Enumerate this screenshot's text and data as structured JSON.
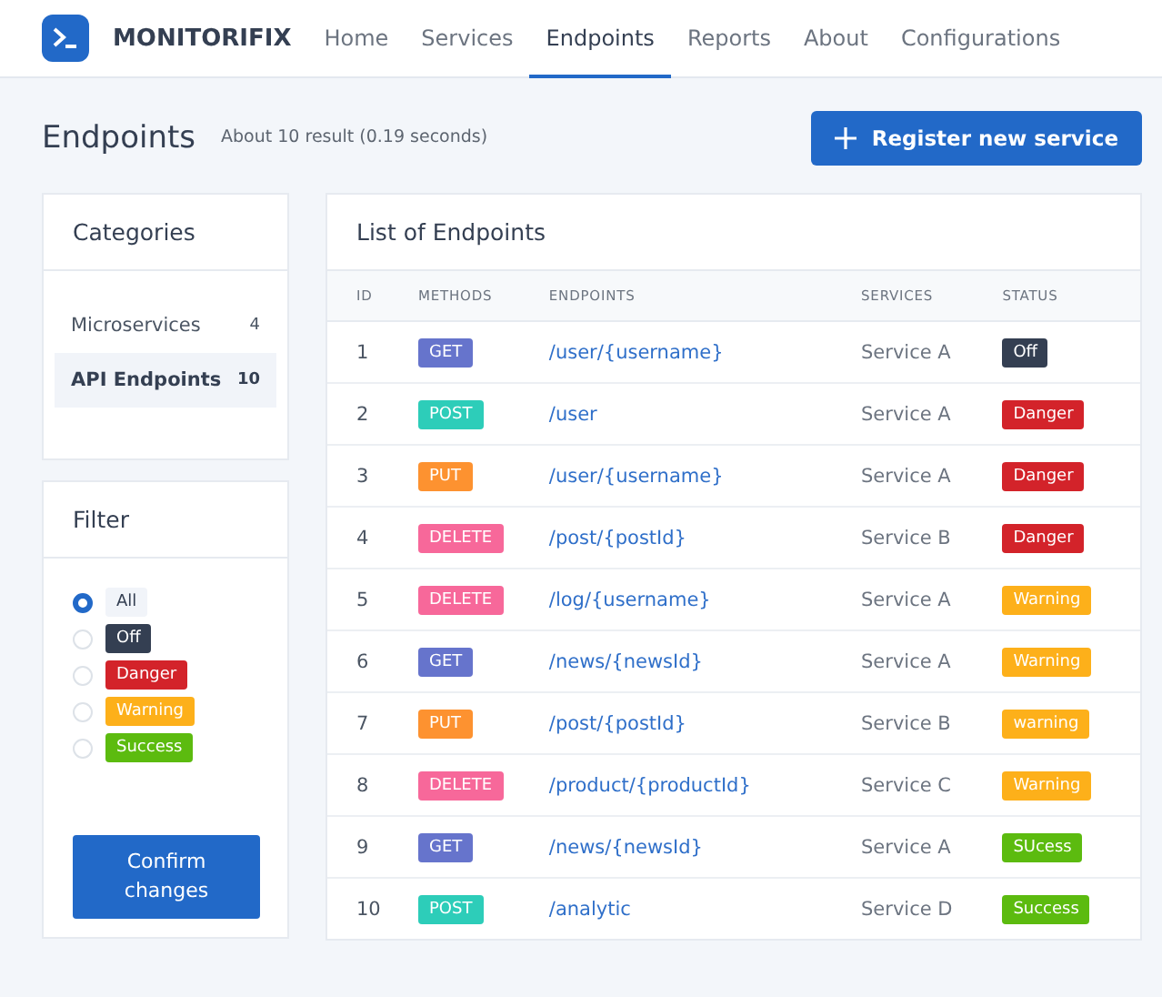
{
  "brand": {
    "name": "MONITORIFIX"
  },
  "nav": [
    {
      "label": "Home",
      "selected": false
    },
    {
      "label": "Services",
      "selected": false
    },
    {
      "label": "Endpoints",
      "selected": true
    },
    {
      "label": "Reports",
      "selected": false
    },
    {
      "label": "About",
      "selected": false
    },
    {
      "label": "Configurations",
      "selected": false
    }
  ],
  "page": {
    "title": "Endpoints",
    "result_info": "About 10 result (0.19 seconds)",
    "action_button": "Register new service"
  },
  "categories": {
    "title": "Categories",
    "items": [
      {
        "label": "Microservices",
        "count": "4",
        "selected": false
      },
      {
        "label": "API Endpoints",
        "count": "10",
        "selected": true
      }
    ]
  },
  "filter": {
    "title": "Filter",
    "options": [
      {
        "label": "All",
        "color": "#f1f4f9",
        "selected": true
      },
      {
        "label": "Off",
        "color": "#343f52",
        "selected": false
      },
      {
        "label": "Danger",
        "color": "#d3232a",
        "selected": false
      },
      {
        "label": "Warning",
        "color": "#fdb01a",
        "selected": false
      },
      {
        "label": "Success",
        "color": "#5cbb0f",
        "selected": false
      }
    ],
    "button": "Confirm changes"
  },
  "table": {
    "title": "List of Endpoints",
    "columns": [
      "ID",
      "METHODS",
      "ENDPOINTS",
      "SERVICES",
      "STATUS"
    ],
    "rows": [
      {
        "id": "1",
        "method": {
          "label": "GET",
          "color": "#6674cc"
        },
        "endpoint": "/user/{username}",
        "service": "Service A",
        "status": {
          "label": "Off",
          "color": "#343f52"
        }
      },
      {
        "id": "2",
        "method": {
          "label": "POST",
          "color": "#2dcdb9"
        },
        "endpoint": "/user",
        "service": "Service A",
        "status": {
          "label": "Danger",
          "color": "#d3232a"
        }
      },
      {
        "id": "3",
        "method": {
          "label": "PUT",
          "color": "#fd9230"
        },
        "endpoint": "/user/{username}",
        "service": "Service A",
        "status": {
          "label": "Danger",
          "color": "#d3232a"
        }
      },
      {
        "id": "4",
        "method": {
          "label": "DELETE",
          "color": "#f7689a"
        },
        "endpoint": "/post/{postId}",
        "service": "Service B",
        "status": {
          "label": "Danger",
          "color": "#d3232a"
        }
      },
      {
        "id": "5",
        "method": {
          "label": "DELETE",
          "color": "#f7689a"
        },
        "endpoint": "/log/{username}",
        "service": "Service A",
        "status": {
          "label": "Warning",
          "color": "#fdb01a"
        }
      },
      {
        "id": "6",
        "method": {
          "label": "GET",
          "color": "#6674cc"
        },
        "endpoint": "/news/{newsId}",
        "service": "Service A",
        "status": {
          "label": "Warning",
          "color": "#fdb01a"
        }
      },
      {
        "id": "7",
        "method": {
          "label": "PUT",
          "color": "#fd9230"
        },
        "endpoint": "/post/{postId}",
        "service": "Service B",
        "status": {
          "label": "warning",
          "color": "#fdb01a"
        }
      },
      {
        "id": "8",
        "method": {
          "label": "DELETE",
          "color": "#f7689a"
        },
        "endpoint": "/product/{productId}",
        "service": "Service C",
        "status": {
          "label": "Warning",
          "color": "#fdb01a"
        }
      },
      {
        "id": "9",
        "method": {
          "label": "GET",
          "color": "#6674cc"
        },
        "endpoint": "/news/{newsId}",
        "service": "Service A",
        "status": {
          "label": "SUcess",
          "color": "#5cbb0f"
        }
      },
      {
        "id": "10",
        "method": {
          "label": "POST",
          "color": "#2dcdb9"
        },
        "endpoint": "/analytic",
        "service": "Service D",
        "status": {
          "label": "Success",
          "color": "#5cbb0f"
        }
      }
    ]
  }
}
